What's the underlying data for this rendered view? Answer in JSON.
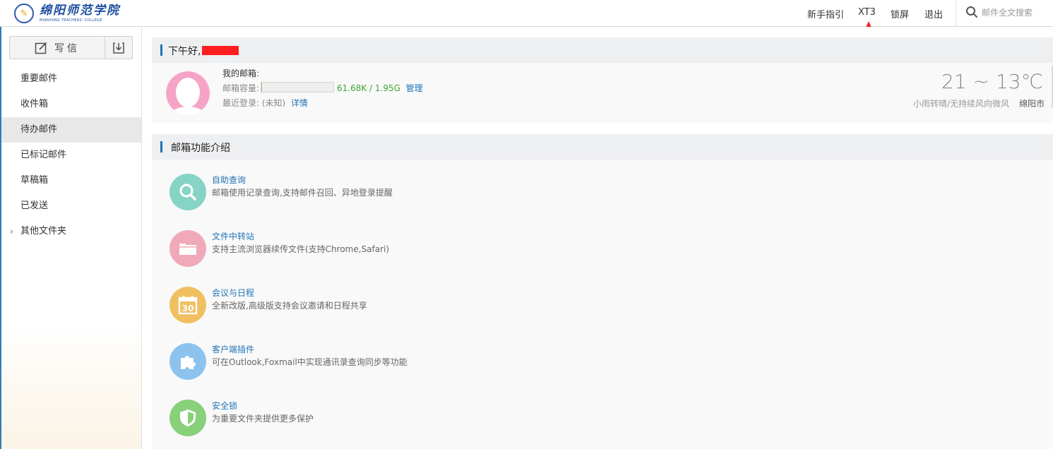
{
  "header": {
    "logo_cn": "绵阳师范学院",
    "logo_en": "MIANYANG TEACHERS' COLLEGE",
    "nav": [
      {
        "label": "新手指引"
      },
      {
        "label": "XT3"
      },
      {
        "label": "锁屏"
      },
      {
        "label": "退出"
      }
    ],
    "search_placeholder": "邮件全文搜索"
  },
  "sidebar": {
    "compose_label": "写信",
    "folders": [
      {
        "label": "重要邮件",
        "active": false
      },
      {
        "label": "收件箱",
        "active": false
      },
      {
        "label": "待办邮件",
        "active": true
      },
      {
        "label": "已标记邮件",
        "active": false
      },
      {
        "label": "草稿箱",
        "active": false
      },
      {
        "label": "已发送",
        "active": false
      },
      {
        "label": "其他文件夹",
        "active": false,
        "collapsible": true
      }
    ]
  },
  "welcome": {
    "greeting": "下午好,",
    "mailbox_label": "我的邮箱:",
    "capacity_label": "邮箱容量:",
    "capacity_used_fraction": 0.001,
    "capacity_text": "61.68K / 1.95G",
    "manage_label": "管理",
    "last_login_label": "最近登录:",
    "last_login_value": "(未知)",
    "details_label": "详情"
  },
  "weather": {
    "temperature": "21 ~ 13℃",
    "description": "小雨转晴/无持续风向微风",
    "city": "绵阳市"
  },
  "features": {
    "title": "邮箱功能介绍",
    "items": [
      {
        "title": "自助查询",
        "desc": "邮箱使用记录查询,支持邮件召回、异地登录提醒",
        "icon": "search-icon",
        "color": "#86d4c6"
      },
      {
        "title": "文件中转站",
        "desc": "支持主流浏览器续传文件(支持Chrome,Safari)",
        "icon": "folder-icon",
        "color": "#f0a9b8"
      },
      {
        "title": "会议与日程",
        "desc": "全新改版,高级版支持会议邀请和日程共享",
        "icon": "calendar-icon",
        "color": "#f0c060",
        "calendar_day": "30"
      },
      {
        "title": "客户端插件",
        "desc": "可在Outlook,Foxmail中实现通讯录查询同步等功能",
        "icon": "puzzle-icon",
        "color": "#8cc3ee"
      },
      {
        "title": "安全锁",
        "desc": "为重要文件夹提供更多保护",
        "icon": "shield-icon",
        "color": "#88d07a"
      }
    ]
  },
  "colors": {
    "accent": "#1f73b7",
    "annotation_arrow": "#ee2222",
    "redaction": "#ff1e1e"
  }
}
